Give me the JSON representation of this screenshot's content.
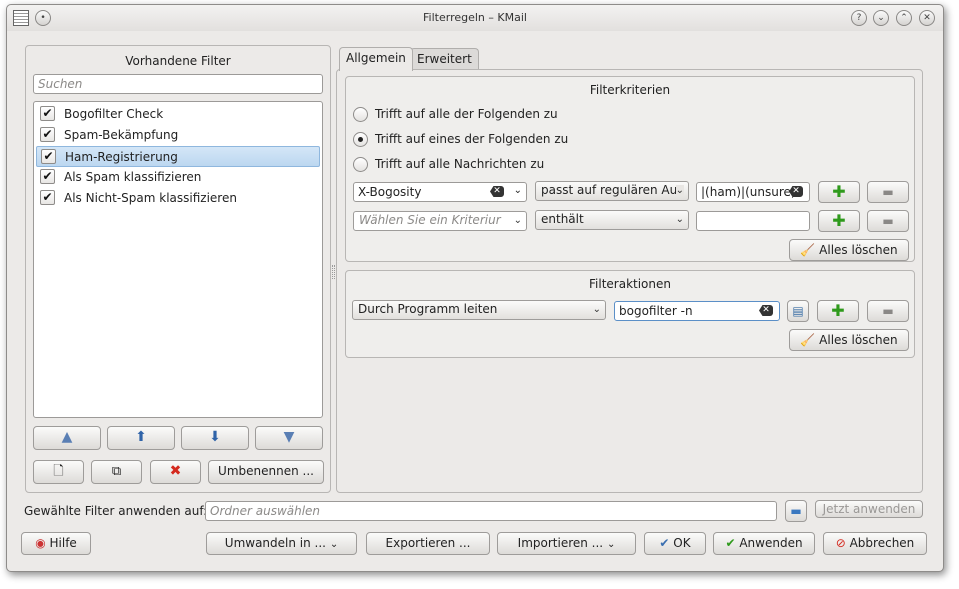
{
  "window": {
    "title": "Filterregeln – KMail"
  },
  "title_buttons": {
    "help": "?",
    "minimize": "⌄",
    "maximize": "⌃",
    "close": "✕"
  },
  "left_panel": {
    "title": "Vorhandene Filter",
    "search_placeholder": "Suchen",
    "filters": [
      {
        "label": "Bogofilter Check",
        "checked": true,
        "selected": false
      },
      {
        "label": "Spam-Bekämpfung",
        "checked": true,
        "selected": false
      },
      {
        "label": "Ham-Registrierung",
        "checked": true,
        "selected": true
      },
      {
        "label": "Als Spam klassifizieren",
        "checked": true,
        "selected": false
      },
      {
        "label": "Als Nicht-Spam klassifizieren",
        "checked": true,
        "selected": false
      }
    ],
    "rename_label": "Umbenennen ..."
  },
  "tabs": [
    {
      "label": "Allgemein",
      "active": true
    },
    {
      "label": "Erweitert",
      "active": false
    }
  ],
  "criteria": {
    "title": "Filterkriterien",
    "radios": [
      {
        "label": "Trifft auf alle der Folgenden zu",
        "checked": false
      },
      {
        "label": "Trifft auf eines der Folgenden zu",
        "checked": true
      },
      {
        "label": "Trifft auf alle Nachrichten zu",
        "checked": false
      }
    ],
    "rules": [
      {
        "field": "X-Bogosity",
        "operator": "passt auf regulären Au",
        "value": "|(ham)|(unsure)"
      },
      {
        "field_placeholder": "Wählen Sie ein Kriteriur",
        "operator": "enthält",
        "value": ""
      }
    ],
    "clear_all": "Alles löschen"
  },
  "actions": {
    "title": "Filteraktionen",
    "action": "Durch Programm leiten",
    "value": "bogofilter -n",
    "clear_all": "Alles löschen"
  },
  "apply_row": {
    "label": "Gewählte Filter anwenden auf:",
    "folder_placeholder": "Ordner auswählen",
    "apply_now": "Jetzt anwenden"
  },
  "bottom_buttons": {
    "help": "Hilfe",
    "convert": "Umwandeln in ...",
    "export": "Exportieren ...",
    "import": "Importieren ...",
    "ok": "OK",
    "apply": "Anwenden",
    "cancel": "Abbrechen"
  },
  "colors": {
    "selection": "#bcd7f0",
    "add_green": "#2f9a1c",
    "cancel_red": "#d42a1f"
  }
}
